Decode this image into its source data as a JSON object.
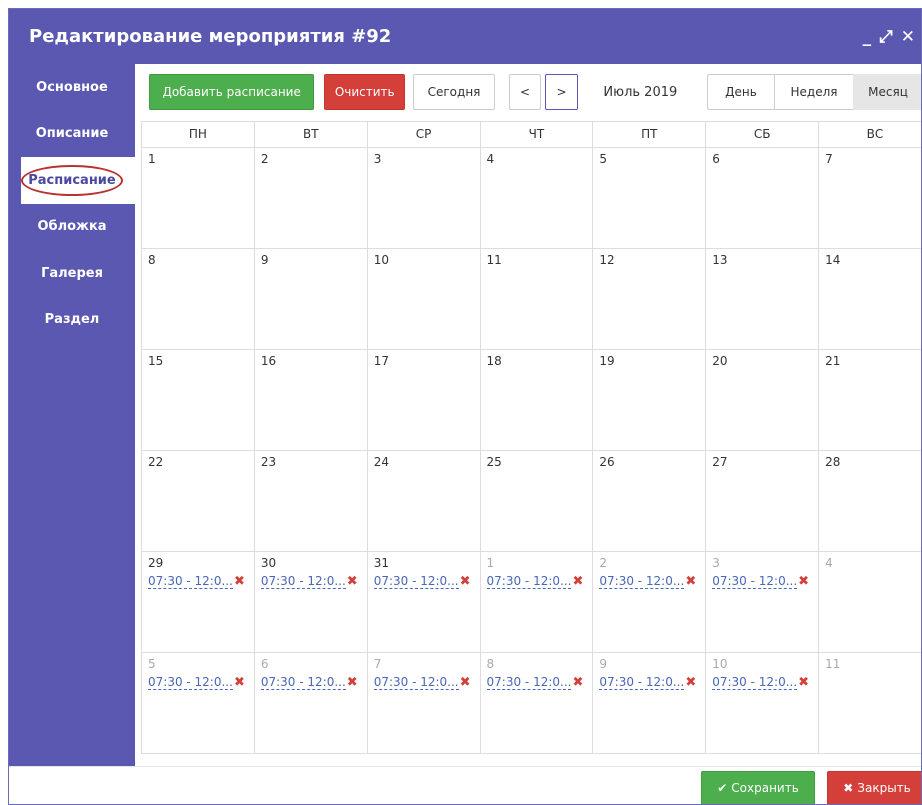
{
  "window": {
    "title": "Редактирование мероприятия #92",
    "controls": {
      "minimize": "_",
      "maximize": "⤢",
      "close": "✕"
    }
  },
  "sidebar": {
    "items": [
      {
        "label": "Основное",
        "active": false
      },
      {
        "label": "Описание",
        "active": false
      },
      {
        "label": "Расписание",
        "active": true
      },
      {
        "label": "Обложка",
        "active": false
      },
      {
        "label": "Галерея",
        "active": false
      },
      {
        "label": "Раздел",
        "active": false
      }
    ]
  },
  "toolbar": {
    "add_schedule": "Добавить расписание",
    "clear": "Очистить",
    "today": "Сегодня",
    "prev": "<",
    "next": ">",
    "month_label": "Июль 2019",
    "views": {
      "day": "День",
      "week": "Неделя",
      "month": "Месяц"
    },
    "active_view": "month"
  },
  "calendar": {
    "weekdays": [
      "ПН",
      "ВТ",
      "СР",
      "ЧТ",
      "ПТ",
      "СБ",
      "ВС"
    ],
    "event_text": "07:30 - 12:0...",
    "event_delete": "✖",
    "weeks": [
      [
        {
          "day": "1"
        },
        {
          "day": "2"
        },
        {
          "day": "3"
        },
        {
          "day": "4"
        },
        {
          "day": "5"
        },
        {
          "day": "6"
        },
        {
          "day": "7"
        }
      ],
      [
        {
          "day": "8"
        },
        {
          "day": "9"
        },
        {
          "day": "10"
        },
        {
          "day": "11"
        },
        {
          "day": "12"
        },
        {
          "day": "13"
        },
        {
          "day": "14"
        }
      ],
      [
        {
          "day": "15"
        },
        {
          "day": "16"
        },
        {
          "day": "17"
        },
        {
          "day": "18"
        },
        {
          "day": "19"
        },
        {
          "day": "20"
        },
        {
          "day": "21"
        }
      ],
      [
        {
          "day": "22"
        },
        {
          "day": "23"
        },
        {
          "day": "24"
        },
        {
          "day": "25"
        },
        {
          "day": "26"
        },
        {
          "day": "27"
        },
        {
          "day": "28"
        }
      ],
      [
        {
          "day": "29",
          "event": true
        },
        {
          "day": "30",
          "event": true
        },
        {
          "day": "31",
          "event": true
        },
        {
          "day": "1",
          "other": true,
          "event": true
        },
        {
          "day": "2",
          "other": true,
          "event": true
        },
        {
          "day": "3",
          "other": true,
          "event": true
        },
        {
          "day": "4",
          "other": true
        }
      ],
      [
        {
          "day": "5",
          "other": true,
          "event": true
        },
        {
          "day": "6",
          "other": true,
          "event": true
        },
        {
          "day": "7",
          "other": true,
          "event": true
        },
        {
          "day": "8",
          "other": true,
          "event": true
        },
        {
          "day": "9",
          "other": true,
          "event": true
        },
        {
          "day": "10",
          "other": true,
          "event": true
        },
        {
          "day": "11",
          "other": true
        }
      ]
    ]
  },
  "footer": {
    "save": "Сохранить",
    "save_icon": "✔",
    "close": "Закрыть",
    "close_icon": "✖"
  },
  "colors": {
    "accent": "#5a58b0",
    "success": "#4cae4c",
    "danger": "#d43f3a",
    "event_link": "#4a67b8"
  }
}
